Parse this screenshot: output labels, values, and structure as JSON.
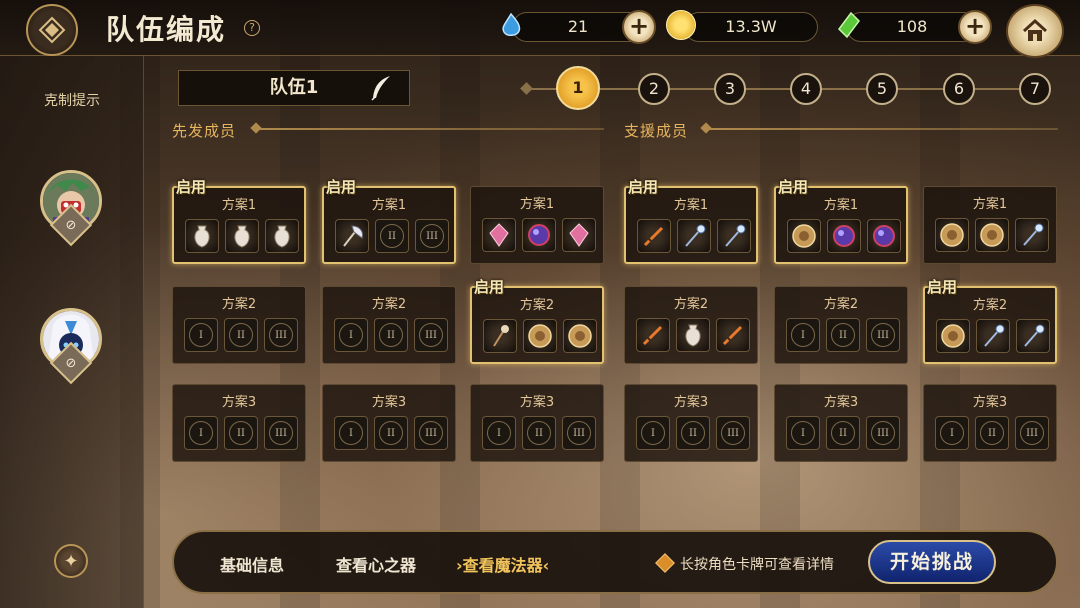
{
  "header": {
    "title": "队伍编成",
    "help": "?"
  },
  "resources": [
    {
      "name": "water-drop",
      "value": "21",
      "color": "#4aa8e8"
    },
    {
      "name": "gold-coin",
      "value": "13.3W",
      "color": "#f0c030"
    },
    {
      "name": "green-crystal",
      "value": "108",
      "color": "#6ad040"
    }
  ],
  "sidebar": {
    "title": "克制提示"
  },
  "team": {
    "name": "队伍1",
    "numbers": [
      "1",
      "2",
      "3",
      "4",
      "5",
      "6",
      "7"
    ],
    "active_index": 0
  },
  "sections": {
    "starters": "先发成员",
    "support": "支援成员"
  },
  "enabled_label": "启用",
  "roman": [
    "I",
    "II",
    "III"
  ],
  "columns": [
    {
      "plans": [
        {
          "title": "方案1",
          "enabled": true,
          "items": [
            "vase",
            "vase",
            "vase"
          ]
        },
        {
          "title": "方案2",
          "enabled": false,
          "items": [
            null,
            null,
            null
          ]
        },
        {
          "title": "方案3",
          "enabled": false,
          "items": [
            null,
            null,
            null
          ]
        }
      ]
    },
    {
      "plans": [
        {
          "title": "方案1",
          "enabled": true,
          "items": [
            "axe",
            null,
            null
          ]
        },
        {
          "title": "方案2",
          "enabled": false,
          "items": [
            null,
            null,
            null
          ]
        },
        {
          "title": "方案3",
          "enabled": false,
          "items": [
            null,
            null,
            null
          ]
        }
      ]
    },
    {
      "plans": [
        {
          "title": "方案1",
          "enabled": false,
          "items": [
            "gem",
            "orb",
            "gem"
          ]
        },
        {
          "title": "方案2",
          "enabled": true,
          "items": [
            "wand",
            "shield",
            "shield"
          ]
        },
        {
          "title": "方案3",
          "enabled": false,
          "items": [
            null,
            null,
            null
          ]
        }
      ]
    },
    {
      "plans": [
        {
          "title": "方案1",
          "enabled": true,
          "items": [
            "sword",
            "staff",
            "staff"
          ]
        },
        {
          "title": "方案2",
          "enabled": false,
          "items": [
            "sword",
            "vase",
            "sword"
          ]
        },
        {
          "title": "方案3",
          "enabled": false,
          "items": [
            null,
            null,
            null
          ]
        }
      ]
    },
    {
      "plans": [
        {
          "title": "方案1",
          "enabled": true,
          "items": [
            "shield",
            "orb",
            "orb"
          ]
        },
        {
          "title": "方案2",
          "enabled": false,
          "items": [
            null,
            null,
            null
          ]
        },
        {
          "title": "方案3",
          "enabled": false,
          "items": [
            null,
            null,
            null
          ]
        }
      ]
    },
    {
      "plans": [
        {
          "title": "方案1",
          "enabled": false,
          "items": [
            "shield",
            "shield",
            "staff"
          ]
        },
        {
          "title": "方案2",
          "enabled": true,
          "items": [
            "shield",
            "staff",
            "staff"
          ]
        },
        {
          "title": "方案3",
          "enabled": false,
          "items": [
            null,
            null,
            null
          ]
        }
      ]
    }
  ],
  "bottom": {
    "tabs": [
      "基础信息",
      "查看心之器",
      "查看魔法器"
    ],
    "active_tab": 2,
    "hint": "长按角色卡牌可查看详情",
    "start": "开始挑战"
  },
  "colors": {
    "accent_gold": "#e2c270",
    "active_number": "#f6c24a",
    "start_button": "#1d3a96"
  }
}
